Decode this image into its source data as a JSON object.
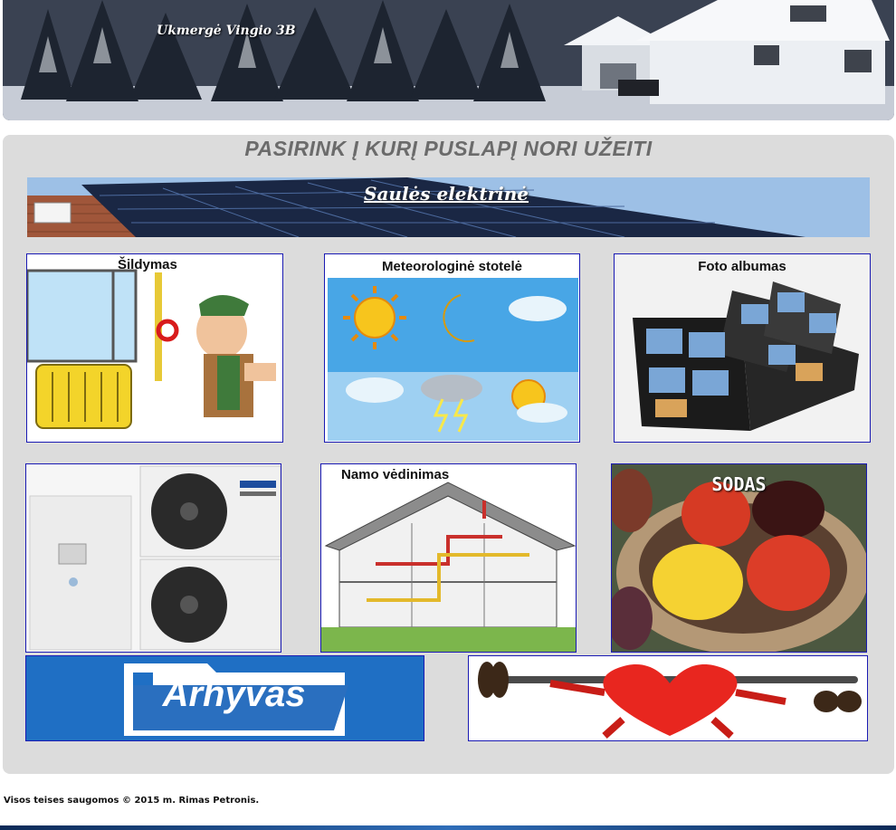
{
  "header": {
    "title": "Ukmergė Vingio 3B"
  },
  "main": {
    "heading": "PASIRINK Į KURĮ PUSLAPĮ NORI UŽEITI",
    "solar_link": "Saulės elektrinė",
    "tiles": [
      {
        "label": "Šildymas",
        "icon": "heating-radiator-cartoon"
      },
      {
        "label": "Meteorologinė stotelė",
        "icon": "weather-icons"
      },
      {
        "label": "Foto albumas",
        "icon": "photo-album"
      },
      {
        "label": "",
        "icon": "heat-pump-units"
      },
      {
        "label": "Namo vėdinimas",
        "icon": "house-ventilation"
      },
      {
        "label": "SODAS",
        "icon": "fruit-basket"
      },
      {
        "label": "Arhyvas",
        "icon": "archive-folder"
      },
      {
        "label": "",
        "icon": "heart-dumbbell"
      }
    ]
  },
  "footer": {
    "text": "Visos teises saugomos © 2015 m. Rimas Petronis."
  },
  "colors": {
    "panel": "#dcdcdc",
    "tile_border": "#1a1ab3",
    "heading": "#6b6b6b",
    "archive_blue": "#1f6fc4"
  }
}
